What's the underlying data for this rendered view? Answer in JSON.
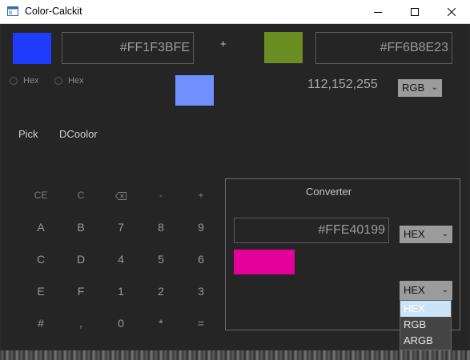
{
  "window": {
    "title": "Color-Calckit",
    "controls": {
      "minimize_icon": "minimize-icon",
      "maximize_icon": "maximize-icon",
      "close_icon": "close-icon"
    }
  },
  "color_a": {
    "swatch": "#1F3BFE",
    "hex": "#FF1F3BFE",
    "radio_label": "Hex"
  },
  "operator": "+",
  "color_b": {
    "swatch": "#6B8E23",
    "hex": "#FF6B8E23",
    "radio_label": "Hex"
  },
  "result": {
    "swatch": "#7090FF",
    "value": "112,152,255",
    "format": "RGB"
  },
  "actions": {
    "pick": "Pick",
    "dcoolor": "DCoolor"
  },
  "keypad": [
    [
      "CE",
      "C",
      "backspace-icon",
      "-",
      "+"
    ],
    [
      "A",
      "B",
      "7",
      "8",
      "9"
    ],
    [
      "C",
      "D",
      "4",
      "5",
      "6"
    ],
    [
      "E",
      "F",
      "1",
      "2",
      "3"
    ],
    [
      "#",
      ",",
      "0",
      "*",
      "="
    ]
  ],
  "converter": {
    "title": "Converter",
    "input": "#FFE40199",
    "input_format": "HEX",
    "swatch": "#E40199",
    "output_format": "HEX",
    "options": [
      "HEX",
      "RGB",
      "ARGB"
    ],
    "highlighted_option": "HEX"
  }
}
